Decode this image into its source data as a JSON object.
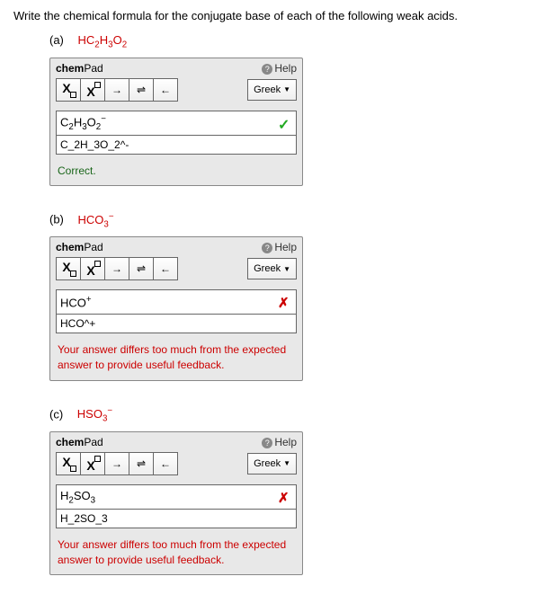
{
  "question": "Write the chemical formula for the conjugate base of each of the following weak acids.",
  "parts": [
    {
      "label": "(a)",
      "given_html": "HC<sub>2</sub>H<sub>3</sub>O<sub>2</sub>",
      "display_html": "C<sub>2</sub>H<sub>3</sub>O<sub>2</sub><sup>−</sup>",
      "raw": "C_2H_3O_2^-",
      "status": "correct",
      "feedback": "Correct."
    },
    {
      "label": "(b)",
      "given_html": "HCO<sub>3</sub><sup>−</sup>",
      "display_html": "HCO<sup>+</sup>",
      "raw": "HCO^+",
      "status": "wrong",
      "feedback": "Your answer differs too much from the expected answer to provide useful feedback."
    },
    {
      "label": "(c)",
      "given_html": "HSO<sub>3</sub><sup>−</sup>",
      "display_html": "H<sub>2</sub>SO<sub>3</sub>",
      "raw": "H_2SO_3",
      "status": "wrong",
      "feedback": "Your answer differs too much from the expected answer to provide useful feedback."
    }
  ],
  "pad": {
    "title_bold": "chem",
    "title_rest": "Pad",
    "help": "Help",
    "greek": "Greek",
    "arrow": "→",
    "equil": "⇌",
    "back": "←"
  }
}
